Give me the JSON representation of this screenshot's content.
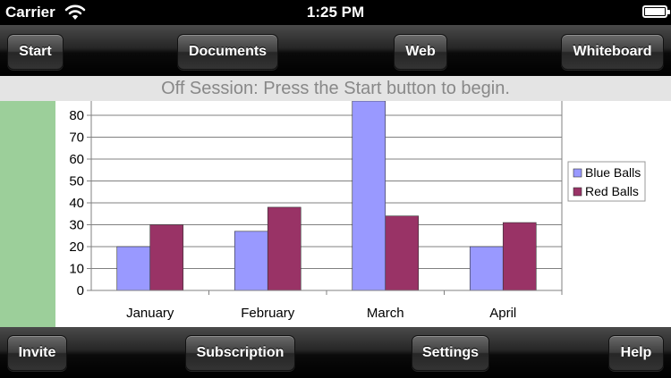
{
  "status_bar": {
    "carrier": "Carrier",
    "time": "1:25 PM"
  },
  "top_toolbar": {
    "start": "Start",
    "documents": "Documents",
    "web": "Web",
    "whiteboard": "Whiteboard"
  },
  "banner": {
    "message": "Off Session: Press the Start button to begin."
  },
  "bottom_toolbar": {
    "invite": "Invite",
    "subscription": "Subscription",
    "settings": "Settings",
    "help": "Help"
  },
  "colors": {
    "sidebar": "#9ccf9a",
    "blue_series": "#9999ff",
    "red_series": "#993366"
  },
  "chart_data": {
    "type": "bar",
    "categories": [
      "January",
      "February",
      "March",
      "April"
    ],
    "series": [
      {
        "name": "Blue Balls",
        "values": [
          20,
          27,
          88,
          20
        ],
        "color": "#9999ff"
      },
      {
        "name": "Red Balls",
        "values": [
          30,
          38,
          34,
          31
        ],
        "color": "#993366"
      }
    ],
    "yticks": [
      0,
      10,
      20,
      30,
      40,
      50,
      60,
      70,
      80
    ],
    "ylim": [
      0,
      88
    ],
    "grid": true,
    "legend": "right"
  }
}
